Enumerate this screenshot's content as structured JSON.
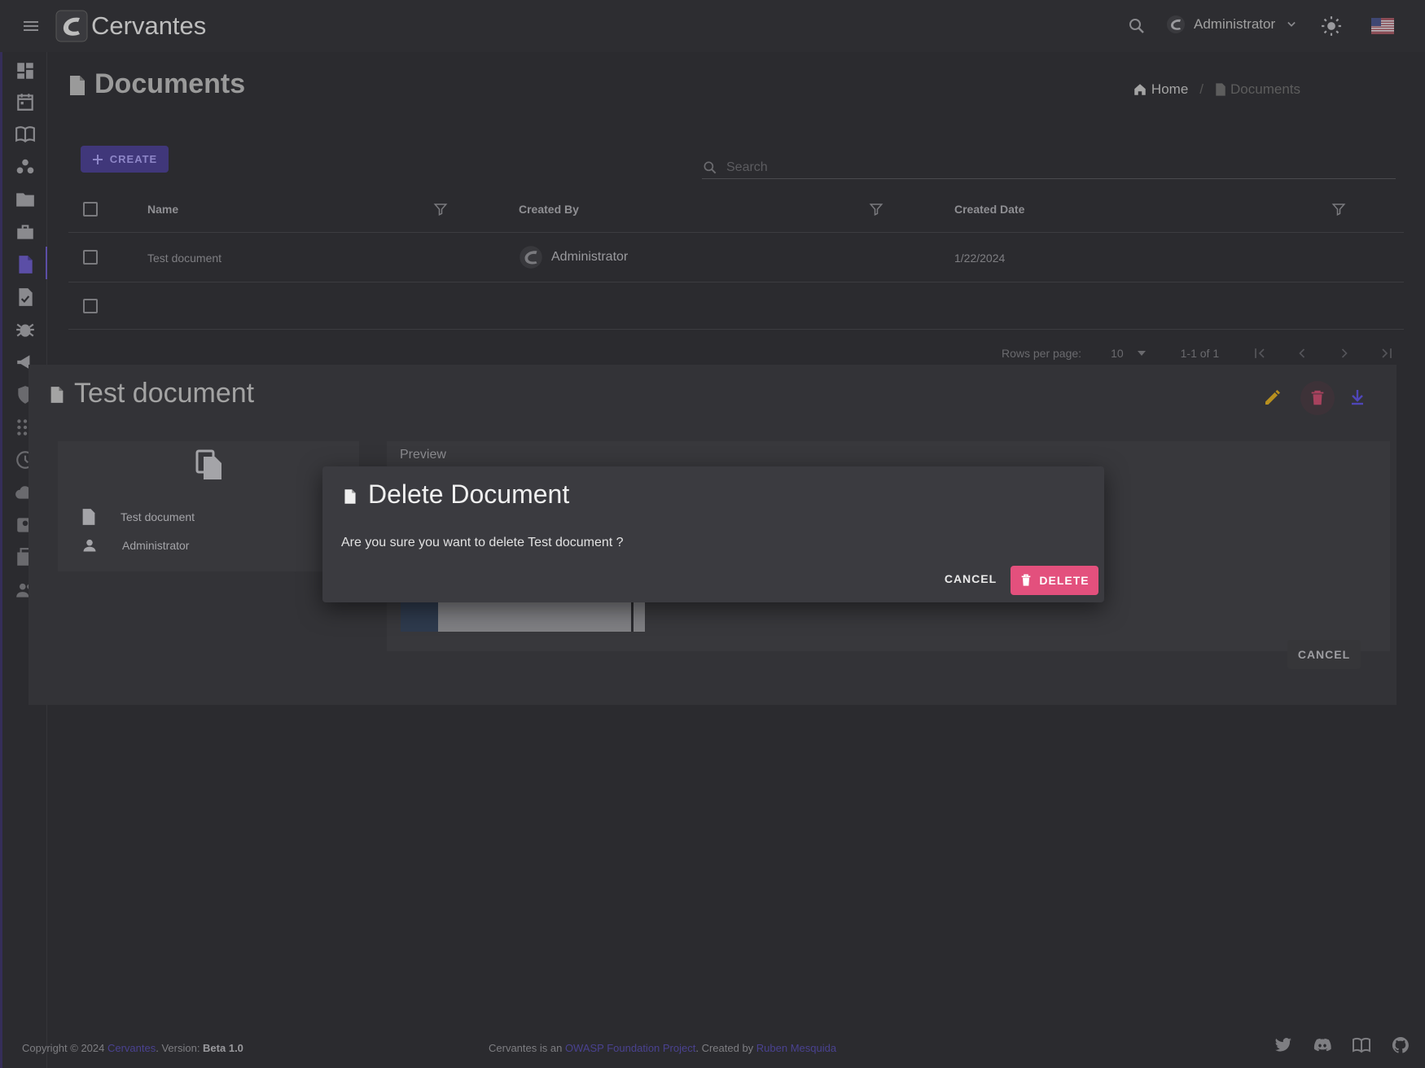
{
  "app": {
    "brand": "Cervantes"
  },
  "topbar": {
    "user_name": "Administrator"
  },
  "page": {
    "title": "Documents"
  },
  "breadcrumb": {
    "home": "Home",
    "current": "Documents"
  },
  "toolbar": {
    "create_label": "CREATE",
    "search_placeholder": "Search"
  },
  "table": {
    "columns": [
      "Name",
      "Created By",
      "Created Date"
    ],
    "rows": [
      {
        "name": "Test document",
        "created_by": "Administrator",
        "created_date": "1/22/2024"
      }
    ]
  },
  "pagination": {
    "rows_per_page_label": "Rows per page:",
    "rows_per_page": "10",
    "range": "1-1 of 1"
  },
  "detail": {
    "title": "Test document",
    "info_name": "Test document",
    "info_user": "Administrator",
    "preview_label": "Preview",
    "cancel_label": "CANCEL"
  },
  "confirm": {
    "title": "Delete Document",
    "message": "Are you sure you want to delete Test document ?",
    "cancel_label": "CANCEL",
    "delete_label": "DELETE"
  },
  "footer": {
    "copyright": "Copyright © 2024 ",
    "brand_link": "Cervantes",
    "version_label": ". Version: ",
    "version": "Beta 1.0",
    "center_prefix": "Cervantes is an ",
    "owasp_link": "OWASP Foundation Project",
    "created_by_label": ". Created by ",
    "author_link": "Ruben Mesquida"
  },
  "colors": {
    "accent": "#5b4ea6",
    "danger": "#e3507d",
    "edit": "#b8901f",
    "download": "#4f46b8"
  }
}
